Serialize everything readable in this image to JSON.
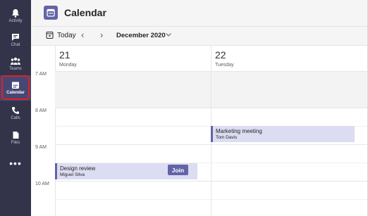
{
  "rail": {
    "items": [
      {
        "label": "Activity",
        "icon": "bell-icon"
      },
      {
        "label": "Chat",
        "icon": "chat-icon"
      },
      {
        "label": "Teams",
        "icon": "teams-icon"
      },
      {
        "label": "Calendar",
        "icon": "calendar-icon",
        "active": true
      },
      {
        "label": "Calls",
        "icon": "phone-icon"
      },
      {
        "label": "Files",
        "icon": "file-icon"
      }
    ],
    "more_label": "•••"
  },
  "header": {
    "title": "Calendar",
    "icon": "calendar-icon"
  },
  "toolbar": {
    "today_label": "Today",
    "prev_label": "‹",
    "next_label": "›",
    "month_label": "December 2020"
  },
  "days": [
    {
      "number": "21",
      "name": "Monday"
    },
    {
      "number": "22",
      "name": "Tuesday"
    }
  ],
  "times": [
    "7 AM",
    "8 AM",
    "9 AM",
    "10 AM"
  ],
  "events": [
    {
      "title": "Marketing meeting",
      "person": "Tom Davis"
    },
    {
      "title": "Design review",
      "person": "Miguel Silva",
      "join_label": "Join"
    }
  ],
  "colors": {
    "rail_bg": "#33344a",
    "accent": "#6264a7",
    "event_bg": "#dcdcf2",
    "highlight": "#e02020"
  }
}
